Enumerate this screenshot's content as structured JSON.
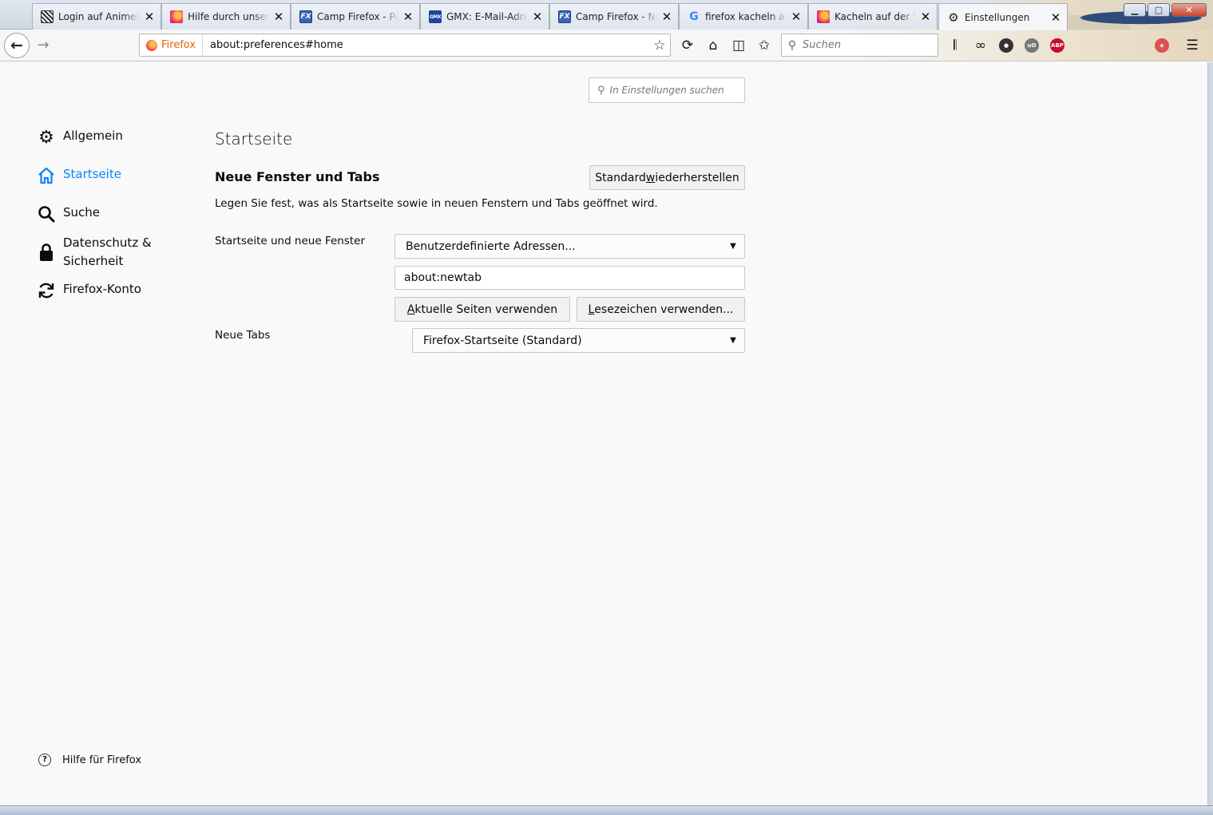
{
  "window": {
    "tabs": [
      {
        "label": "Login auf Animexx",
        "icon": "animexx-favicon"
      },
      {
        "label": "Hilfe durch unsere",
        "icon": "firefox-favicon"
      },
      {
        "label": "Camp Firefox - Pers",
        "icon": "camp-firefox-favicon"
      },
      {
        "label": "GMX: E-Mail-Adress",
        "icon": "gmx-favicon"
      },
      {
        "label": "Camp Firefox - Neu",
        "icon": "camp-firefox-favicon"
      },
      {
        "label": "firefox kacheln anze",
        "icon": "google-favicon"
      },
      {
        "label": "Kacheln auf der Seit",
        "icon": "firefox-favicon"
      },
      {
        "label": "Einstellungen",
        "icon": "gear-icon",
        "active": true
      }
    ]
  },
  "navbar": {
    "identity_label": "Firefox",
    "url": "about:preferences#home",
    "search_placeholder": "Suchen"
  },
  "prefs": {
    "search_placeholder": "In Einstellungen suchen",
    "categories": [
      {
        "label": "Allgemein",
        "icon": "gear-icon"
      },
      {
        "label": "Startseite",
        "icon": "home-icon",
        "selected": true
      },
      {
        "label": "Suche",
        "icon": "search-icon"
      },
      {
        "label": "Datenschutz &\nSicherheit",
        "icon": "lock-icon"
      },
      {
        "label": "Firefox-Konto",
        "icon": "sync-icon"
      }
    ],
    "help_label": "Hilfe für Firefox",
    "page_title": "Startseite",
    "section": {
      "heading": "Neue Fenster und Tabs",
      "restore_btn_pre": "Standard ",
      "restore_btn_acc": "w",
      "restore_btn_post": "iederherstellen",
      "description": "Legen Sie fest, was als Startseite sowie in neuen Fenstern und Tabs geöffnet wird."
    },
    "homepage": {
      "label": "Startseite und neue Fenster",
      "selected": "Benutzerdefinierte Adressen...",
      "url_value": "about:newtab",
      "current_btn_acc": "A",
      "current_btn_rest": "ktuelle Seiten verwenden",
      "bookmark_btn_acc": "L",
      "bookmark_btn_rest": "esezeichen verwenden..."
    },
    "newtabs": {
      "label": "Neue Tabs",
      "selected": "Firefox-Startseite (Standard)"
    }
  },
  "colors": {
    "accent": "#0a84ff",
    "background": "#f9f9fa"
  }
}
